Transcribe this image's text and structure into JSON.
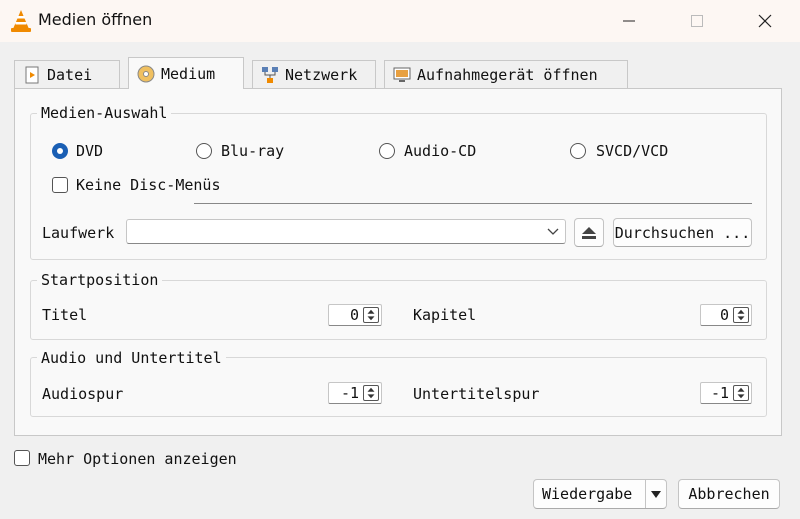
{
  "window": {
    "title": "Medien öffnen"
  },
  "tabs": [
    {
      "label": "Datei",
      "icon": "file-icon"
    },
    {
      "label": "Medium",
      "icon": "disc-icon"
    },
    {
      "label": "Netzwerk",
      "icon": "network-icon"
    },
    {
      "label": "Aufnahmegerät öffnen",
      "icon": "capture-device-icon"
    }
  ],
  "media_selection": {
    "group_label": "Medien-Auswahl",
    "options": [
      {
        "label": "DVD",
        "selected": true
      },
      {
        "label": "Blu-ray",
        "selected": false
      },
      {
        "label": "Audio-CD",
        "selected": false
      },
      {
        "label": "SVCD/VCD",
        "selected": false
      }
    ],
    "no_disc_menus_label": "Keine Disc-Menüs",
    "drive_label": "Laufwerk",
    "drive_value": "",
    "browse_label": "Durchsuchen ..."
  },
  "start_position": {
    "group_label": "Startposition",
    "title_label": "Titel",
    "title_value": "0",
    "chapter_label": "Kapitel",
    "chapter_value": "0"
  },
  "audio_subtitles": {
    "group_label": "Audio und Untertitel",
    "audio_label": "Audiospur",
    "audio_value": "-1",
    "subtitle_label": "Untertitelspur",
    "subtitle_value": "-1"
  },
  "more_options_label": "Mehr Optionen anzeigen",
  "buttons": {
    "play": "Wiedergabe",
    "cancel": "Abbrechen"
  },
  "colors": {
    "accent": "#1a5fb4",
    "vlc_orange": "#f08a00"
  }
}
